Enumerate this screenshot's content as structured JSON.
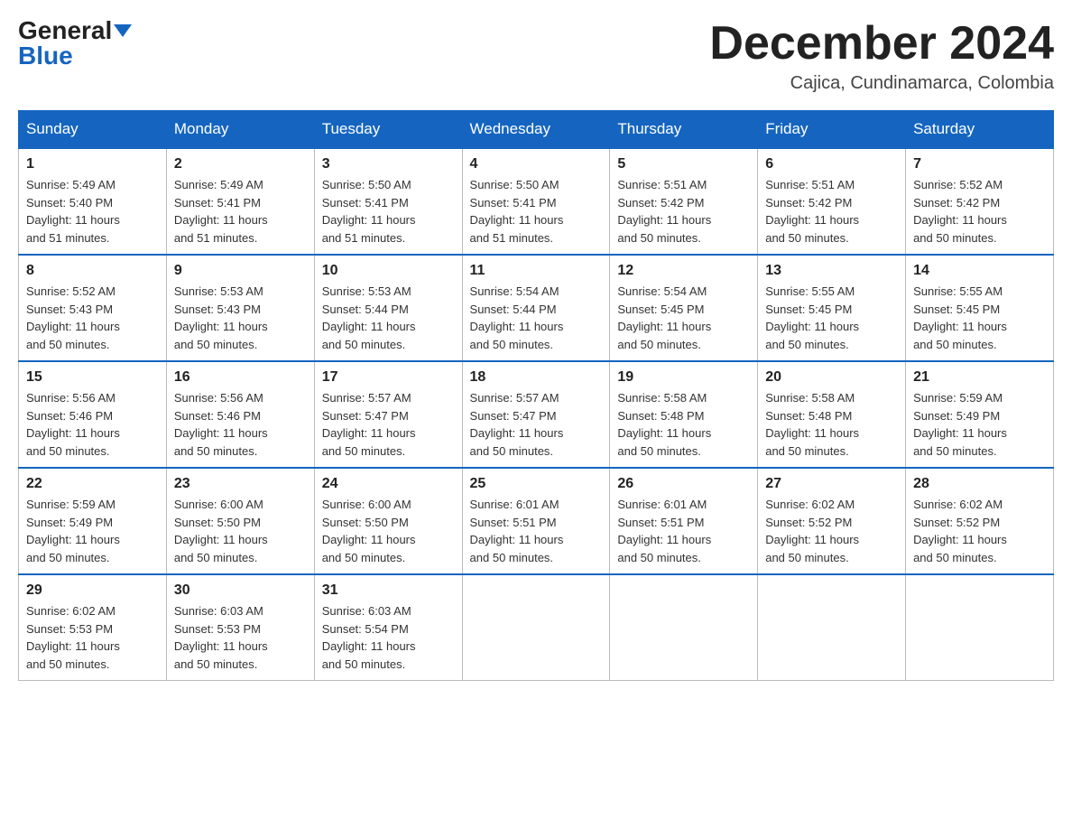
{
  "header": {
    "logo_general": "General",
    "logo_blue": "Blue",
    "month_title": "December 2024",
    "location": "Cajica, Cundinamarca, Colombia"
  },
  "days_of_week": [
    "Sunday",
    "Monday",
    "Tuesday",
    "Wednesday",
    "Thursday",
    "Friday",
    "Saturday"
  ],
  "weeks": [
    [
      {
        "day": "1",
        "sunrise": "5:49 AM",
        "sunset": "5:40 PM",
        "daylight": "11 hours and 51 minutes."
      },
      {
        "day": "2",
        "sunrise": "5:49 AM",
        "sunset": "5:41 PM",
        "daylight": "11 hours and 51 minutes."
      },
      {
        "day": "3",
        "sunrise": "5:50 AM",
        "sunset": "5:41 PM",
        "daylight": "11 hours and 51 minutes."
      },
      {
        "day": "4",
        "sunrise": "5:50 AM",
        "sunset": "5:41 PM",
        "daylight": "11 hours and 51 minutes."
      },
      {
        "day": "5",
        "sunrise": "5:51 AM",
        "sunset": "5:42 PM",
        "daylight": "11 hours and 50 minutes."
      },
      {
        "day": "6",
        "sunrise": "5:51 AM",
        "sunset": "5:42 PM",
        "daylight": "11 hours and 50 minutes."
      },
      {
        "day": "7",
        "sunrise": "5:52 AM",
        "sunset": "5:42 PM",
        "daylight": "11 hours and 50 minutes."
      }
    ],
    [
      {
        "day": "8",
        "sunrise": "5:52 AM",
        "sunset": "5:43 PM",
        "daylight": "11 hours and 50 minutes."
      },
      {
        "day": "9",
        "sunrise": "5:53 AM",
        "sunset": "5:43 PM",
        "daylight": "11 hours and 50 minutes."
      },
      {
        "day": "10",
        "sunrise": "5:53 AM",
        "sunset": "5:44 PM",
        "daylight": "11 hours and 50 minutes."
      },
      {
        "day": "11",
        "sunrise": "5:54 AM",
        "sunset": "5:44 PM",
        "daylight": "11 hours and 50 minutes."
      },
      {
        "day": "12",
        "sunrise": "5:54 AM",
        "sunset": "5:45 PM",
        "daylight": "11 hours and 50 minutes."
      },
      {
        "day": "13",
        "sunrise": "5:55 AM",
        "sunset": "5:45 PM",
        "daylight": "11 hours and 50 minutes."
      },
      {
        "day": "14",
        "sunrise": "5:55 AM",
        "sunset": "5:45 PM",
        "daylight": "11 hours and 50 minutes."
      }
    ],
    [
      {
        "day": "15",
        "sunrise": "5:56 AM",
        "sunset": "5:46 PM",
        "daylight": "11 hours and 50 minutes."
      },
      {
        "day": "16",
        "sunrise": "5:56 AM",
        "sunset": "5:46 PM",
        "daylight": "11 hours and 50 minutes."
      },
      {
        "day": "17",
        "sunrise": "5:57 AM",
        "sunset": "5:47 PM",
        "daylight": "11 hours and 50 minutes."
      },
      {
        "day": "18",
        "sunrise": "5:57 AM",
        "sunset": "5:47 PM",
        "daylight": "11 hours and 50 minutes."
      },
      {
        "day": "19",
        "sunrise": "5:58 AM",
        "sunset": "5:48 PM",
        "daylight": "11 hours and 50 minutes."
      },
      {
        "day": "20",
        "sunrise": "5:58 AM",
        "sunset": "5:48 PM",
        "daylight": "11 hours and 50 minutes."
      },
      {
        "day": "21",
        "sunrise": "5:59 AM",
        "sunset": "5:49 PM",
        "daylight": "11 hours and 50 minutes."
      }
    ],
    [
      {
        "day": "22",
        "sunrise": "5:59 AM",
        "sunset": "5:49 PM",
        "daylight": "11 hours and 50 minutes."
      },
      {
        "day": "23",
        "sunrise": "6:00 AM",
        "sunset": "5:50 PM",
        "daylight": "11 hours and 50 minutes."
      },
      {
        "day": "24",
        "sunrise": "6:00 AM",
        "sunset": "5:50 PM",
        "daylight": "11 hours and 50 minutes."
      },
      {
        "day": "25",
        "sunrise": "6:01 AM",
        "sunset": "5:51 PM",
        "daylight": "11 hours and 50 minutes."
      },
      {
        "day": "26",
        "sunrise": "6:01 AM",
        "sunset": "5:51 PM",
        "daylight": "11 hours and 50 minutes."
      },
      {
        "day": "27",
        "sunrise": "6:02 AM",
        "sunset": "5:52 PM",
        "daylight": "11 hours and 50 minutes."
      },
      {
        "day": "28",
        "sunrise": "6:02 AM",
        "sunset": "5:52 PM",
        "daylight": "11 hours and 50 minutes."
      }
    ],
    [
      {
        "day": "29",
        "sunrise": "6:02 AM",
        "sunset": "5:53 PM",
        "daylight": "11 hours and 50 minutes."
      },
      {
        "day": "30",
        "sunrise": "6:03 AM",
        "sunset": "5:53 PM",
        "daylight": "11 hours and 50 minutes."
      },
      {
        "day": "31",
        "sunrise": "6:03 AM",
        "sunset": "5:54 PM",
        "daylight": "11 hours and 50 minutes."
      },
      null,
      null,
      null,
      null
    ]
  ],
  "labels": {
    "sunrise": "Sunrise:",
    "sunset": "Sunset:",
    "daylight": "Daylight:"
  }
}
